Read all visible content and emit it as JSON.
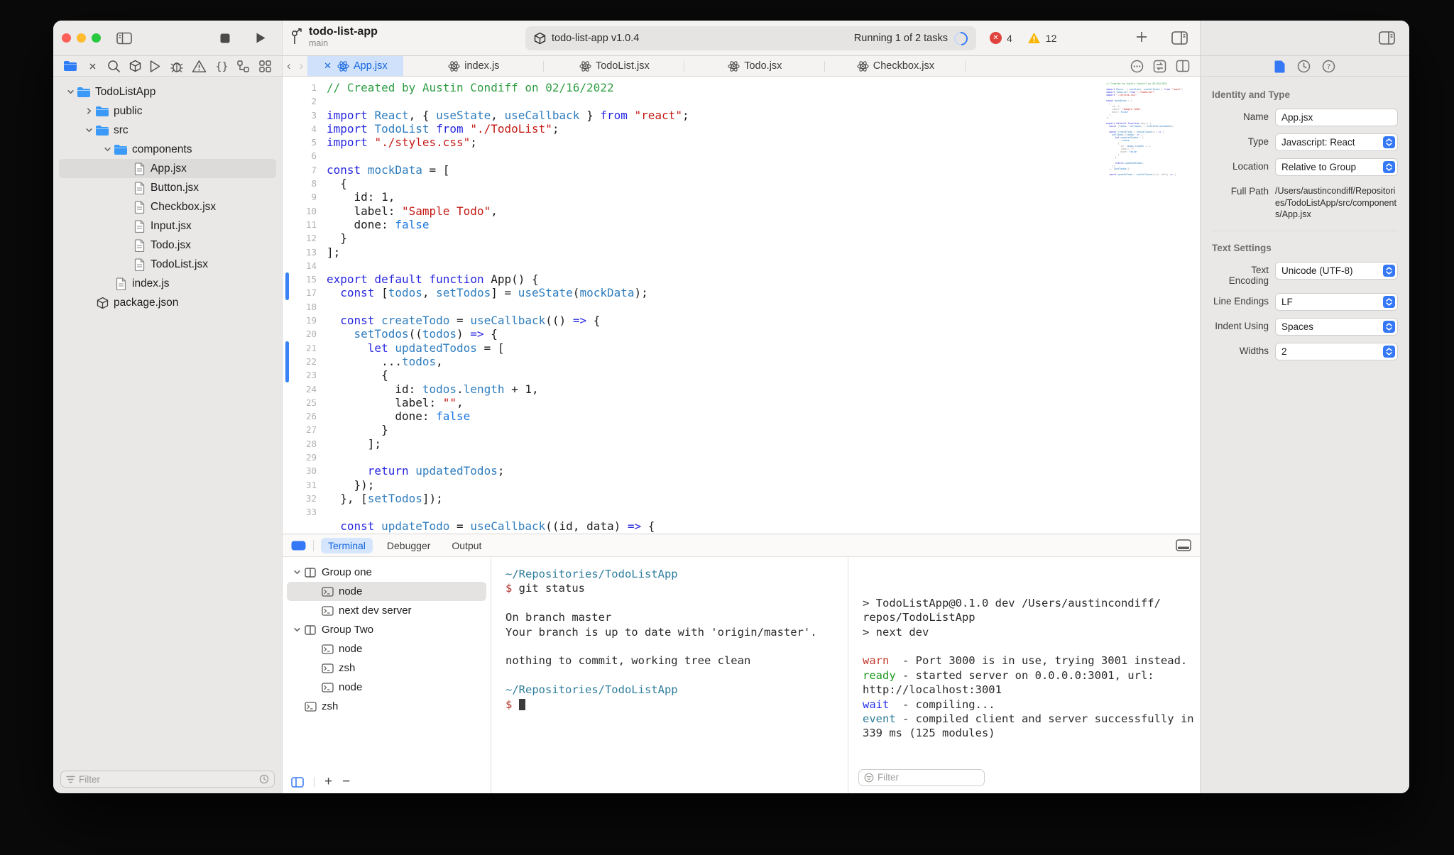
{
  "toolbar": {
    "project_name": "todo-list-app",
    "branch": "main",
    "scheme_label": "todo-list-app v1.0.4",
    "status_label": "Running 1 of 2 tasks",
    "error_count": "4",
    "warning_count": "12"
  },
  "navigator_icons": [
    "folder-icon",
    "source-control-icon",
    "search-icon",
    "package-icon",
    "run-icon",
    "bug-icon",
    "warning-icon",
    "braces-icon",
    "hierarchy-icon",
    "grid-icon"
  ],
  "file_tree": {
    "items": [
      {
        "depth": 0,
        "chevron": "open",
        "icon": "folder-icon",
        "label": "TodoListApp"
      },
      {
        "depth": 1,
        "chevron": "closed",
        "icon": "folder-icon",
        "label": "public"
      },
      {
        "depth": 1,
        "chevron": "open",
        "icon": "folder-icon",
        "label": "src"
      },
      {
        "depth": 2,
        "chevron": "open",
        "icon": "folder-icon",
        "label": "components"
      },
      {
        "depth": 3,
        "chevron": "none",
        "icon": "file-icon",
        "label": "App.jsx",
        "selected": true
      },
      {
        "depth": 3,
        "chevron": "none",
        "icon": "file-icon",
        "label": "Button.jsx"
      },
      {
        "depth": 3,
        "chevron": "none",
        "icon": "file-icon",
        "label": "Checkbox.jsx"
      },
      {
        "depth": 3,
        "chevron": "none",
        "icon": "file-icon",
        "label": "Input.jsx"
      },
      {
        "depth": 3,
        "chevron": "none",
        "icon": "file-icon",
        "label": "Todo.jsx"
      },
      {
        "depth": 3,
        "chevron": "none",
        "icon": "file-icon",
        "label": "TodoList.jsx"
      },
      {
        "depth": 2,
        "chevron": "none",
        "icon": "file-icon",
        "label": "index.js"
      },
      {
        "depth": 1,
        "chevron": "none",
        "icon": "package-icon",
        "label": "package.json"
      }
    ],
    "filter_placeholder": "Filter"
  },
  "editor_tabs": {
    "items": [
      {
        "label": "App.jsx",
        "active": true
      },
      {
        "label": "index.js",
        "active": false
      },
      {
        "label": "TodoList.jsx",
        "active": false
      },
      {
        "label": "Todo.jsx",
        "active": false
      },
      {
        "label": "Checkbox.jsx",
        "active": false
      }
    ]
  },
  "editor": {
    "lines": [
      "// Created by Austin Condiff on 02/16/2022",
      "",
      "import React, { useState, useCallback } from \"react\";",
      "import TodoList from \"./TodoList\";",
      "import \"./styles.css\";",
      "",
      "const mockData = [",
      "  {",
      "    id: 1,",
      "    label: \"Sample Todo\",",
      "    done: false",
      "  }",
      "];",
      "",
      "export default function App() {",
      "  const [todos, setTodos] = useState(mockData);",
      "",
      "  const createTodo = useCallback(() => {",
      "    setTodos((todos) => {",
      "      let updatedTodos = [",
      "        ...todos,",
      "        {",
      "          id: todos.length + 1,",
      "          label: \"\",",
      "          done: false",
      "        }",
      "      ];",
      "",
      "      return updatedTodos;",
      "    });",
      "  }, [setTodos]);",
      "",
      "  const updateTodo = useCallback((id, data) => {"
    ],
    "hidden_line_numbers": [
      16
    ],
    "change_bars": [
      {
        "from": 15,
        "to": 16
      },
      {
        "from": 20,
        "to": 22
      }
    ]
  },
  "inspector": {
    "sections": [
      {
        "title": "Identity and Type",
        "rows": [
          {
            "label": "Name",
            "control": "input",
            "value": "App.jsx"
          },
          {
            "label": "Type",
            "control": "select",
            "value": "Javascript: React"
          },
          {
            "label": "Location",
            "control": "select",
            "value": "Relative to Group"
          },
          {
            "label": "Full Path",
            "control": "static",
            "value": "/Users/austincondiff/Repositories/TodoListApp/src/components/App.jsx"
          }
        ]
      },
      {
        "title": "Text Settings",
        "rows": [
          {
            "label": "Text Encoding",
            "control": "select",
            "value": "Unicode (UTF-8)"
          },
          {
            "label": "Line Endings",
            "control": "select",
            "value": "LF"
          },
          {
            "label": "Indent Using",
            "control": "select",
            "value": "Spaces"
          },
          {
            "label": "Widths",
            "control": "select",
            "value": "2"
          }
        ]
      }
    ]
  },
  "bottom_panel": {
    "tabs": [
      {
        "label": "Terminal",
        "active": true
      },
      {
        "label": "Debugger",
        "active": false
      },
      {
        "label": "Output",
        "active": false
      }
    ],
    "sessions": [
      {
        "depth": 0,
        "icon": "group-icon",
        "label": "Group one",
        "chevron": true,
        "selected": false
      },
      {
        "depth": 1,
        "icon": "terminal-icon",
        "label": "node",
        "chevron": false,
        "selected": true
      },
      {
        "depth": 1,
        "icon": "terminal-icon",
        "label": "next dev server",
        "chevron": false,
        "selected": false
      },
      {
        "depth": 0,
        "icon": "group-icon",
        "label": "Group Two",
        "chevron": true,
        "selected": false
      },
      {
        "depth": 1,
        "icon": "terminal-icon",
        "label": "node",
        "chevron": false,
        "selected": false
      },
      {
        "depth": 1,
        "icon": "terminal-icon",
        "label": "zsh",
        "chevron": false,
        "selected": false
      },
      {
        "depth": 1,
        "icon": "terminal-icon",
        "label": "node",
        "chevron": false,
        "selected": false
      },
      {
        "depth": 0,
        "icon": "terminal-icon",
        "label": "zsh",
        "chevron": false,
        "selected": false
      }
    ],
    "terminal_left": [
      [
        {
          "c": "path",
          "t": "~/Repositories/TodoListApp"
        }
      ],
      [
        {
          "c": "dollar",
          "t": "$"
        },
        {
          "c": "fg",
          "t": " git status"
        }
      ],
      [],
      [
        {
          "c": "fg",
          "t": "On branch master"
        }
      ],
      [
        {
          "c": "fg",
          "t": "Your branch is up to date with 'origin/master'."
        }
      ],
      [],
      [
        {
          "c": "fg",
          "t": "nothing to commit, working tree clean"
        }
      ],
      [],
      [
        {
          "c": "path",
          "t": "~/Repositories/TodoListApp"
        }
      ],
      [
        {
          "c": "dollar",
          "t": "$"
        },
        {
          "c": "fg",
          "t": " "
        },
        {
          "c": "cursor",
          "t": " "
        }
      ]
    ],
    "terminal_right": [
      [
        {
          "c": "fg",
          "t": "> TodoListApp@0.1.0 dev /Users/austincondiff/"
        }
      ],
      [
        {
          "c": "fg",
          "t": "repos/TodoListApp"
        }
      ],
      [
        {
          "c": "fg",
          "t": "> next dev"
        }
      ],
      [],
      [
        {
          "c": "warn",
          "t": "warn"
        },
        {
          "c": "fg",
          "t": "  - Port 3000 is in use, trying 3001 instead."
        }
      ],
      [
        {
          "c": "ready",
          "t": "ready"
        },
        {
          "c": "fg",
          "t": " - started server on 0.0.0.0:3001, url:"
        }
      ],
      [
        {
          "c": "fg",
          "t": "http://localhost:3001"
        }
      ],
      [
        {
          "c": "wait",
          "t": "wait"
        },
        {
          "c": "fg",
          "t": "  - compiling..."
        }
      ],
      [
        {
          "c": "event",
          "t": "event"
        },
        {
          "c": "fg",
          "t": " - compiled client and server successfully in"
        }
      ],
      [
        {
          "c": "fg",
          "t": "339 ms (125 modules)"
        }
      ]
    ],
    "filter_placeholder": "Filter"
  }
}
